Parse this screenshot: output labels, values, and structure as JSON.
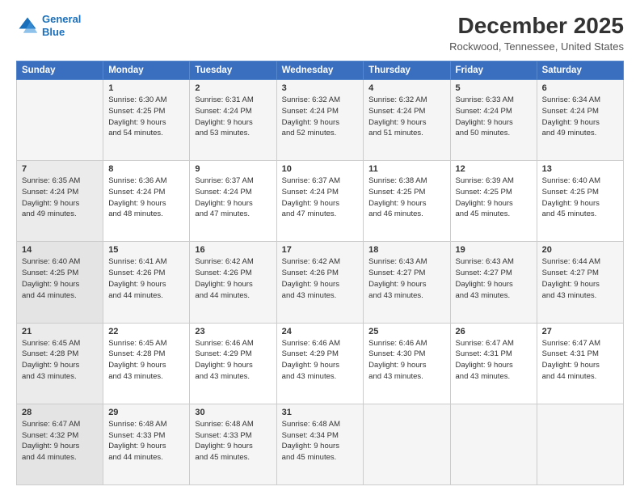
{
  "logo": {
    "line1": "General",
    "line2": "Blue"
  },
  "title": "December 2025",
  "subtitle": "Rockwood, Tennessee, United States",
  "days_of_week": [
    "Sunday",
    "Monday",
    "Tuesday",
    "Wednesday",
    "Thursday",
    "Friday",
    "Saturday"
  ],
  "weeks": [
    [
      {
        "day": "",
        "info": ""
      },
      {
        "day": "1",
        "info": "Sunrise: 6:30 AM\nSunset: 4:25 PM\nDaylight: 9 hours\nand 54 minutes."
      },
      {
        "day": "2",
        "info": "Sunrise: 6:31 AM\nSunset: 4:24 PM\nDaylight: 9 hours\nand 53 minutes."
      },
      {
        "day": "3",
        "info": "Sunrise: 6:32 AM\nSunset: 4:24 PM\nDaylight: 9 hours\nand 52 minutes."
      },
      {
        "day": "4",
        "info": "Sunrise: 6:32 AM\nSunset: 4:24 PM\nDaylight: 9 hours\nand 51 minutes."
      },
      {
        "day": "5",
        "info": "Sunrise: 6:33 AM\nSunset: 4:24 PM\nDaylight: 9 hours\nand 50 minutes."
      },
      {
        "day": "6",
        "info": "Sunrise: 6:34 AM\nSunset: 4:24 PM\nDaylight: 9 hours\nand 49 minutes."
      }
    ],
    [
      {
        "day": "7",
        "info": "Sunrise: 6:35 AM\nSunset: 4:24 PM\nDaylight: 9 hours\nand 49 minutes."
      },
      {
        "day": "8",
        "info": "Sunrise: 6:36 AM\nSunset: 4:24 PM\nDaylight: 9 hours\nand 48 minutes."
      },
      {
        "day": "9",
        "info": "Sunrise: 6:37 AM\nSunset: 4:24 PM\nDaylight: 9 hours\nand 47 minutes."
      },
      {
        "day": "10",
        "info": "Sunrise: 6:37 AM\nSunset: 4:24 PM\nDaylight: 9 hours\nand 47 minutes."
      },
      {
        "day": "11",
        "info": "Sunrise: 6:38 AM\nSunset: 4:25 PM\nDaylight: 9 hours\nand 46 minutes."
      },
      {
        "day": "12",
        "info": "Sunrise: 6:39 AM\nSunset: 4:25 PM\nDaylight: 9 hours\nand 45 minutes."
      },
      {
        "day": "13",
        "info": "Sunrise: 6:40 AM\nSunset: 4:25 PM\nDaylight: 9 hours\nand 45 minutes."
      }
    ],
    [
      {
        "day": "14",
        "info": "Sunrise: 6:40 AM\nSunset: 4:25 PM\nDaylight: 9 hours\nand 44 minutes."
      },
      {
        "day": "15",
        "info": "Sunrise: 6:41 AM\nSunset: 4:26 PM\nDaylight: 9 hours\nand 44 minutes."
      },
      {
        "day": "16",
        "info": "Sunrise: 6:42 AM\nSunset: 4:26 PM\nDaylight: 9 hours\nand 44 minutes."
      },
      {
        "day": "17",
        "info": "Sunrise: 6:42 AM\nSunset: 4:26 PM\nDaylight: 9 hours\nand 43 minutes."
      },
      {
        "day": "18",
        "info": "Sunrise: 6:43 AM\nSunset: 4:27 PM\nDaylight: 9 hours\nand 43 minutes."
      },
      {
        "day": "19",
        "info": "Sunrise: 6:43 AM\nSunset: 4:27 PM\nDaylight: 9 hours\nand 43 minutes."
      },
      {
        "day": "20",
        "info": "Sunrise: 6:44 AM\nSunset: 4:27 PM\nDaylight: 9 hours\nand 43 minutes."
      }
    ],
    [
      {
        "day": "21",
        "info": "Sunrise: 6:45 AM\nSunset: 4:28 PM\nDaylight: 9 hours\nand 43 minutes."
      },
      {
        "day": "22",
        "info": "Sunrise: 6:45 AM\nSunset: 4:28 PM\nDaylight: 9 hours\nand 43 minutes."
      },
      {
        "day": "23",
        "info": "Sunrise: 6:46 AM\nSunset: 4:29 PM\nDaylight: 9 hours\nand 43 minutes."
      },
      {
        "day": "24",
        "info": "Sunrise: 6:46 AM\nSunset: 4:29 PM\nDaylight: 9 hours\nand 43 minutes."
      },
      {
        "day": "25",
        "info": "Sunrise: 6:46 AM\nSunset: 4:30 PM\nDaylight: 9 hours\nand 43 minutes."
      },
      {
        "day": "26",
        "info": "Sunrise: 6:47 AM\nSunset: 4:31 PM\nDaylight: 9 hours\nand 43 minutes."
      },
      {
        "day": "27",
        "info": "Sunrise: 6:47 AM\nSunset: 4:31 PM\nDaylight: 9 hours\nand 44 minutes."
      }
    ],
    [
      {
        "day": "28",
        "info": "Sunrise: 6:47 AM\nSunset: 4:32 PM\nDaylight: 9 hours\nand 44 minutes."
      },
      {
        "day": "29",
        "info": "Sunrise: 6:48 AM\nSunset: 4:33 PM\nDaylight: 9 hours\nand 44 minutes."
      },
      {
        "day": "30",
        "info": "Sunrise: 6:48 AM\nSunset: 4:33 PM\nDaylight: 9 hours\nand 45 minutes."
      },
      {
        "day": "31",
        "info": "Sunrise: 6:48 AM\nSunset: 4:34 PM\nDaylight: 9 hours\nand 45 minutes."
      },
      {
        "day": "",
        "info": ""
      },
      {
        "day": "",
        "info": ""
      },
      {
        "day": "",
        "info": ""
      }
    ]
  ]
}
